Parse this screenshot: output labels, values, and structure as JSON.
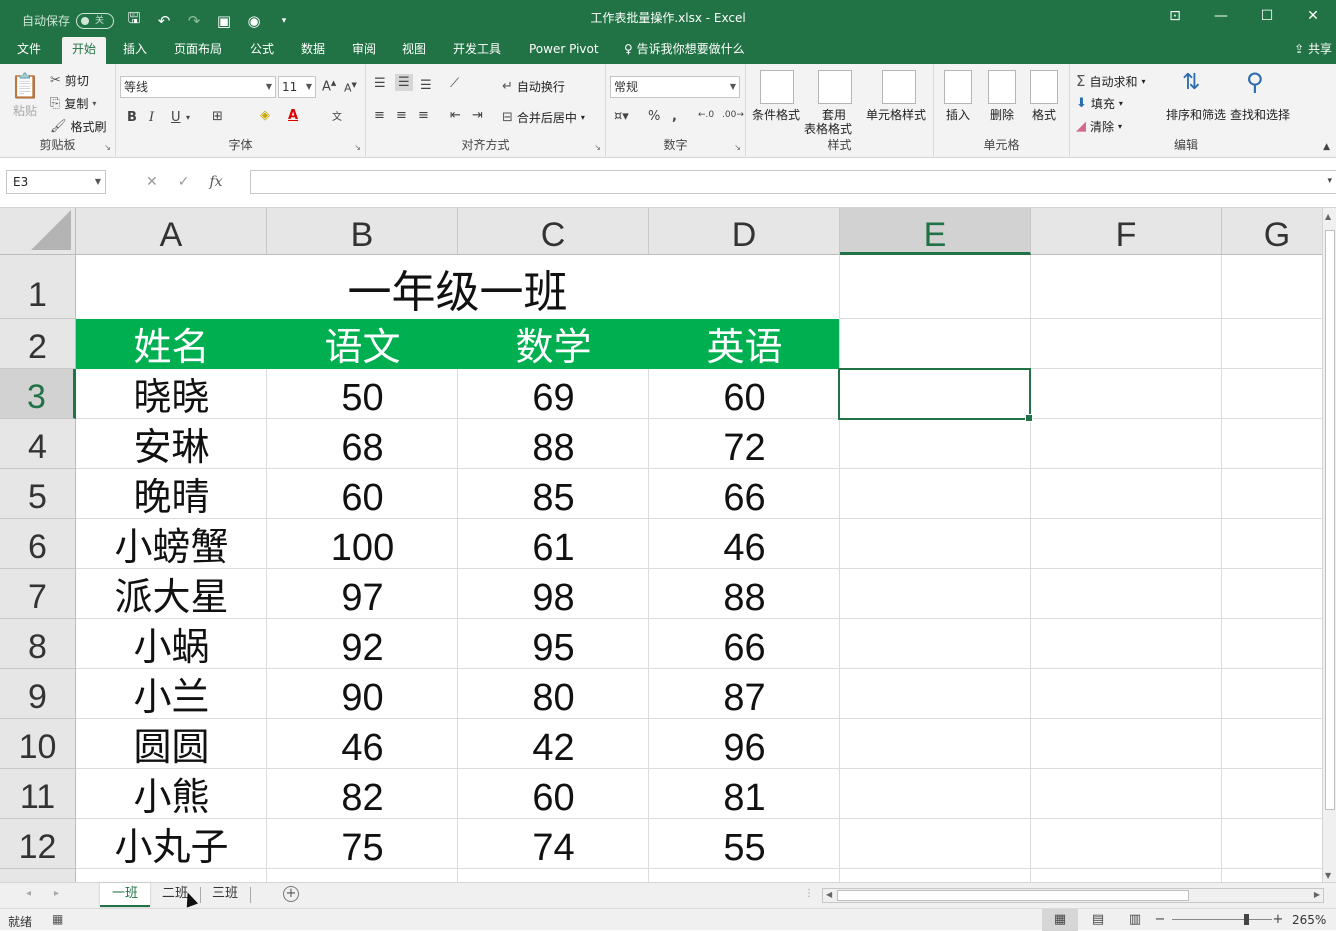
{
  "titlebar": {
    "autosave_label": "自动保存",
    "autosave_state": "关",
    "document_title": "工作表批量操作.xlsx  -  Excel",
    "accent_color": "#217346"
  },
  "ribbon_tabs": [
    "文件",
    "开始",
    "插入",
    "页面布局",
    "公式",
    "数据",
    "审阅",
    "视图",
    "开发工具",
    "Power Pivot"
  ],
  "tell_me": "告诉我你想要做什么",
  "share": "共享",
  "ribbon": {
    "clipboard": {
      "paste": "粘贴",
      "cut": "剪切",
      "copy": "复制",
      "format_painter": "格式刷",
      "label": "剪贴板"
    },
    "font": {
      "name": "等线",
      "size": "11",
      "bold": "B",
      "italic": "I",
      "underline": "U",
      "label": "字体"
    },
    "alignment": {
      "wrap": "自动换行",
      "merge": "合并后居中",
      "label": "对齐方式"
    },
    "number": {
      "format": "常规",
      "percent": "%",
      "label": "数字"
    },
    "styles": {
      "conditional": "条件格式",
      "table_line1": "套用",
      "table_line2": "表格格式",
      "cell_styles": "单元格样式",
      "label": "样式"
    },
    "cells": {
      "insert": "插入",
      "delete": "删除",
      "format": "格式",
      "label": "单元格"
    },
    "editing": {
      "autosum": "自动求和",
      "fill": "填充",
      "clear": "清除",
      "sort": "排序和筛选",
      "find": "查找和选择",
      "label": "编辑"
    }
  },
  "formula_bar": {
    "name_box": "E3",
    "fx": "fx",
    "value": ""
  },
  "columns": [
    "A",
    "B",
    "C",
    "D",
    "E",
    "F",
    "G"
  ],
  "selected_column": "E",
  "rows": [
    "1",
    "2",
    "3",
    "4",
    "5",
    "6",
    "7",
    "8",
    "9",
    "10",
    "11",
    "12"
  ],
  "selected_row": "3",
  "sheet": {
    "title": "一年级一班",
    "header_fill_color": "#00b050",
    "headers": [
      "姓名",
      "语文",
      "数学",
      "英语"
    ],
    "data": [
      [
        "晓晓",
        "50",
        "69",
        "60"
      ],
      [
        "安琳",
        "68",
        "88",
        "72"
      ],
      [
        "晚晴",
        "60",
        "85",
        "66"
      ],
      [
        "小螃蟹",
        "100",
        "61",
        "46"
      ],
      [
        "派大星",
        "97",
        "98",
        "88"
      ],
      [
        "小蜗",
        "92",
        "95",
        "66"
      ],
      [
        "小兰",
        "90",
        "80",
        "87"
      ],
      [
        "圆圆",
        "46",
        "42",
        "96"
      ],
      [
        "小熊",
        "82",
        "60",
        "81"
      ],
      [
        "小丸子",
        "75",
        "74",
        "55"
      ]
    ]
  },
  "sheet_tabs": [
    "一班",
    "二班",
    "三班"
  ],
  "active_sheet": "一班",
  "status": {
    "ready": "就绪",
    "zoom": "265%"
  }
}
